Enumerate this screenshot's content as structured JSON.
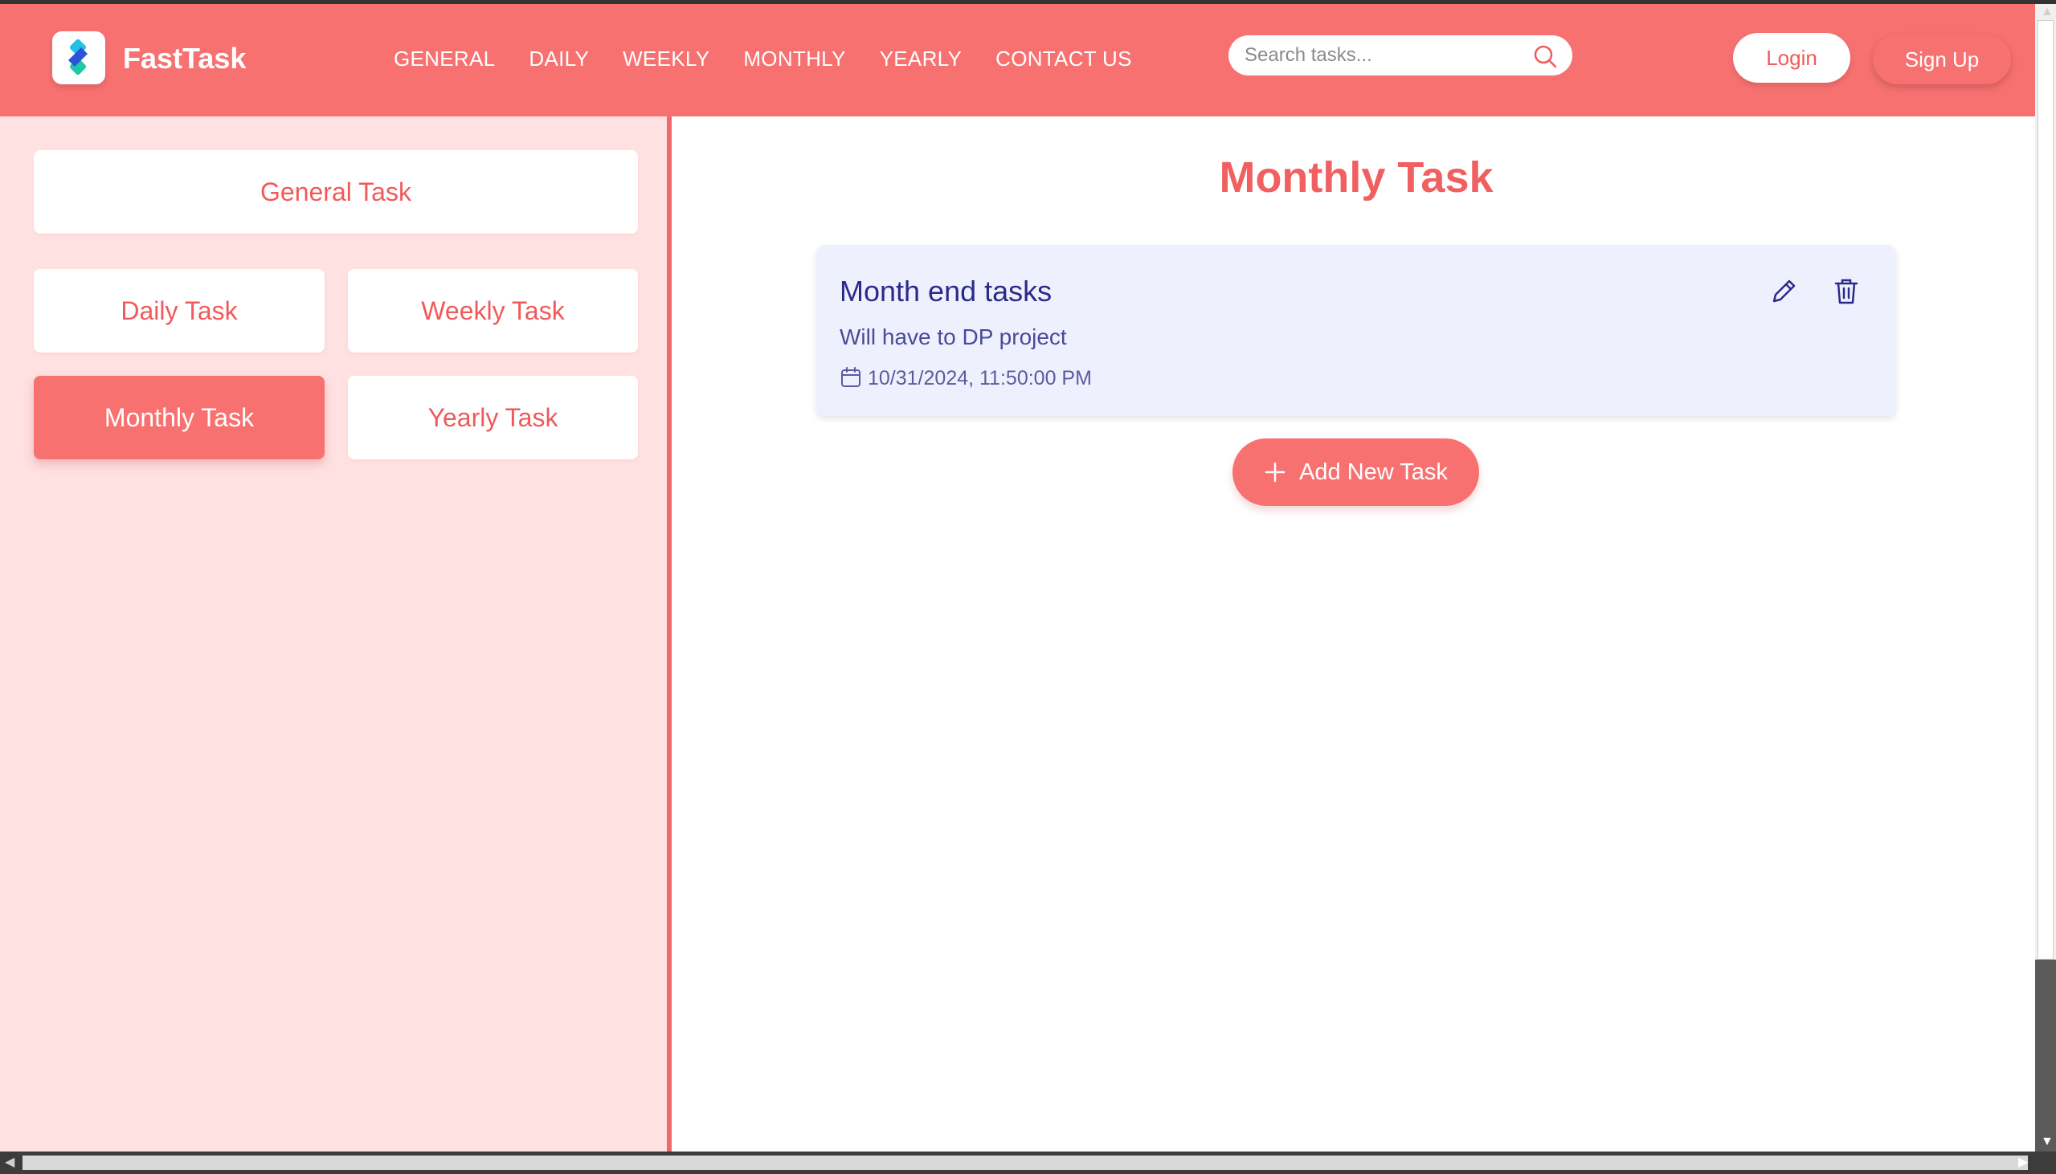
{
  "header": {
    "brand": "FastTask",
    "nav": [
      "GENERAL",
      "DAILY",
      "WEEKLY",
      "MONTHLY",
      "YEARLY",
      "CONTACT US"
    ],
    "search_placeholder": "Search tasks...",
    "login_label": "Login",
    "signup_label": "Sign Up"
  },
  "sidebar": {
    "general": "General Task",
    "daily": "Daily Task",
    "weekly": "Weekly Task",
    "monthly": "Monthly Task",
    "yearly": "Yearly Task",
    "active": "Monthly Task"
  },
  "main": {
    "title": "Monthly Task",
    "tasks": [
      {
        "title": "Month end tasks",
        "description": "Will have to DP project",
        "date": "10/31/2024, 11:50:00 PM"
      }
    ],
    "add_label": "Add New Task"
  },
  "colors": {
    "accent": "#f87171",
    "sidebar_bg": "#ffe1e1",
    "card_bg": "#eef1fd",
    "card_text": "#2b2b8a"
  }
}
